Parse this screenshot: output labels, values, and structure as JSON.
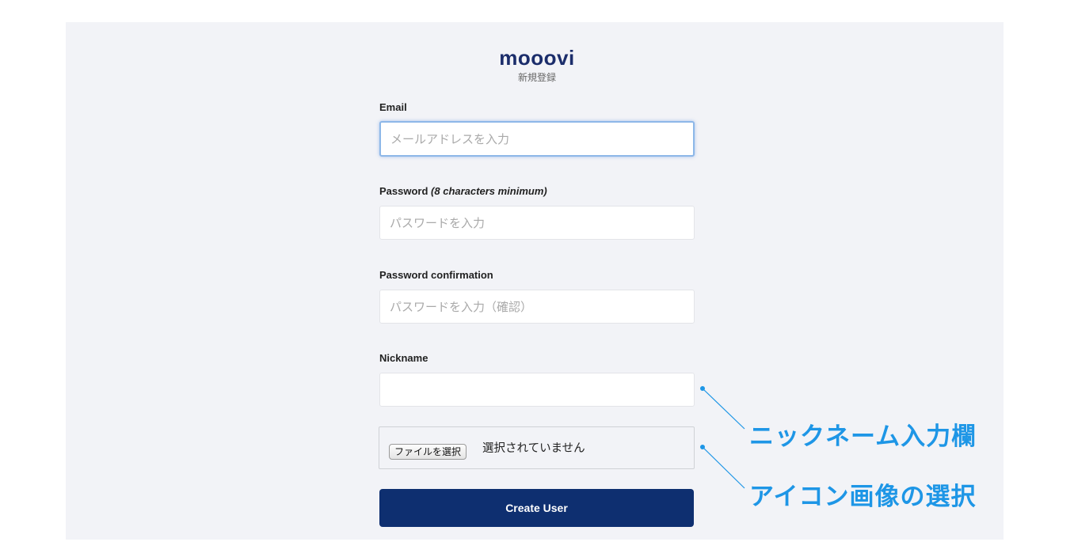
{
  "brand": {
    "logo": "mooovi",
    "subtitle": "新規登録"
  },
  "form": {
    "email": {
      "label": "Email",
      "placeholder": "メールアドレスを入力"
    },
    "password": {
      "label": "Password",
      "hint": "(8 characters minimum)",
      "placeholder": "パスワードを入力"
    },
    "password_confirmation": {
      "label": "Password confirmation",
      "placeholder": "パスワードを入力（確認）"
    },
    "nickname": {
      "label": "Nickname",
      "placeholder": ""
    },
    "avatar": {
      "button_label": "ファイルを選択",
      "status": "選択されていません"
    },
    "submit_label": "Create User"
  },
  "annotations": {
    "nickname_note": "ニックネーム入力欄",
    "avatar_note": "アイコン画像の選択"
  },
  "colors": {
    "brand": "#1b2d6b",
    "submit_button": "#0e2f70",
    "annotation": "#1e96e6",
    "background": "#f2f3f7"
  }
}
